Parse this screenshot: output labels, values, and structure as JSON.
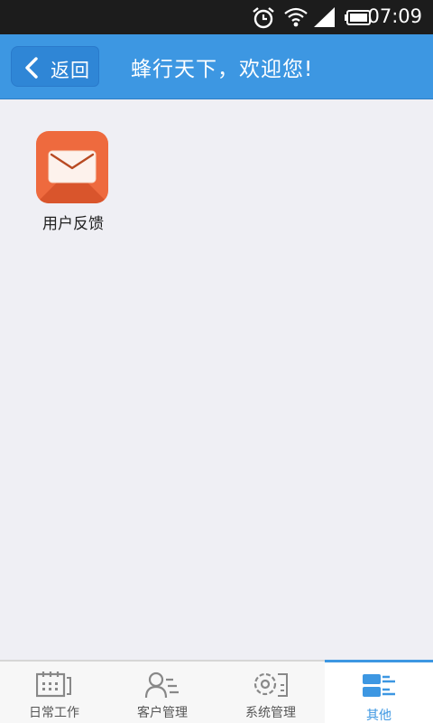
{
  "status_bar": {
    "time": "07:09"
  },
  "header": {
    "back_label": "返回",
    "title": "蜂行天下，欢迎您!"
  },
  "tiles": [
    {
      "label": "用户反馈",
      "icon": "mail-icon"
    }
  ],
  "tabs": [
    {
      "label": "日常工作",
      "icon": "calendar-icon"
    },
    {
      "label": "客户管理",
      "icon": "contacts-icon"
    },
    {
      "label": "系统管理",
      "icon": "settings-icon"
    },
    {
      "label": "其他",
      "icon": "list-icon",
      "active": true
    }
  ],
  "colors": {
    "header": "#3d97e2",
    "tile": "#ee6a3e",
    "accent": "#3d97e2"
  }
}
